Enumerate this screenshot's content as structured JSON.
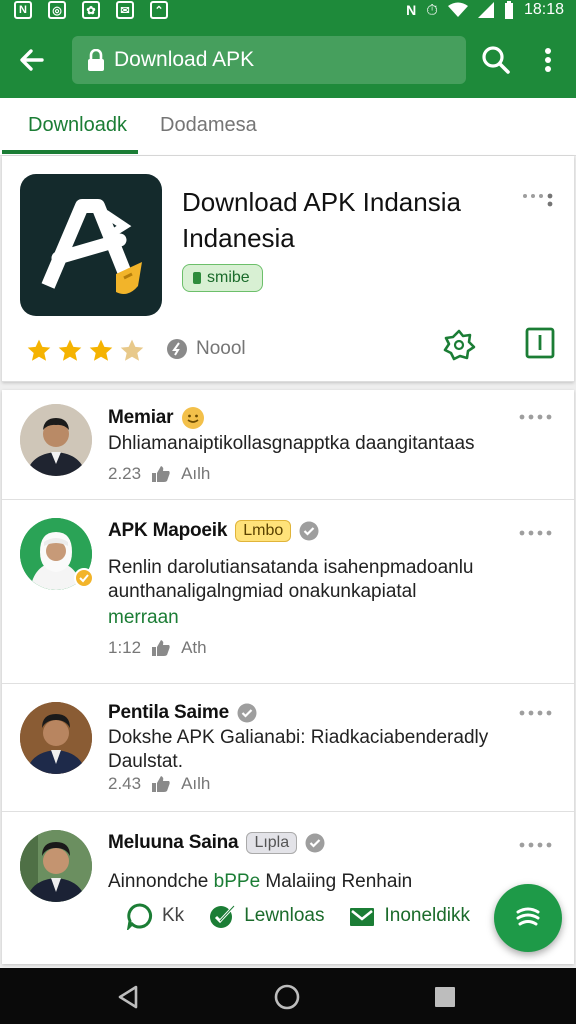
{
  "status_bar": {
    "time": "18:18"
  },
  "app_bar": {
    "url_text": "Download APK"
  },
  "tabs": [
    {
      "label": "Downloadk",
      "active": true
    },
    {
      "label": "Dodamesa",
      "active": false
    }
  ],
  "app_card": {
    "title": "Download APK Indansia Indanesia",
    "badge": "smibe",
    "rating_stars": 3,
    "rating_max": 4,
    "label": "Noool"
  },
  "posts": [
    {
      "name": "Memiar",
      "text": "Dhliamanaiptikollasgnapptka daangitantaas",
      "time": "2.23",
      "meta": "Aılh"
    },
    {
      "name": "APK Mapoeik",
      "tag": "Lmbo",
      "text": "Renlin darolutiansatanda isahenpmadoanlu aunthanaligalngmiad onakunkapiatal",
      "link": "merraan",
      "time": "1:12",
      "meta": "Ath"
    },
    {
      "name": "Pentila Saime",
      "text": "Dokshe APK Galianabi: Riadkaciabenderadly Daulstat.",
      "time": "2.43",
      "meta": "Aılh"
    },
    {
      "name": "Meluuna Saina",
      "tag": "Lıpla",
      "text_before": "Ainnondche ",
      "text_link": "bPPe",
      "text_after": " Malaiing Renhain"
    }
  ],
  "actions": [
    {
      "label": "Kk",
      "icon": "comment-icon"
    },
    {
      "label": "Lewnloas",
      "icon": "check-icon"
    },
    {
      "label": "Inoneldikk",
      "icon": "mail-icon"
    }
  ],
  "colors": {
    "primary": "#1e8a3a",
    "accent": "#1b7d35",
    "star": "#f5b301"
  }
}
